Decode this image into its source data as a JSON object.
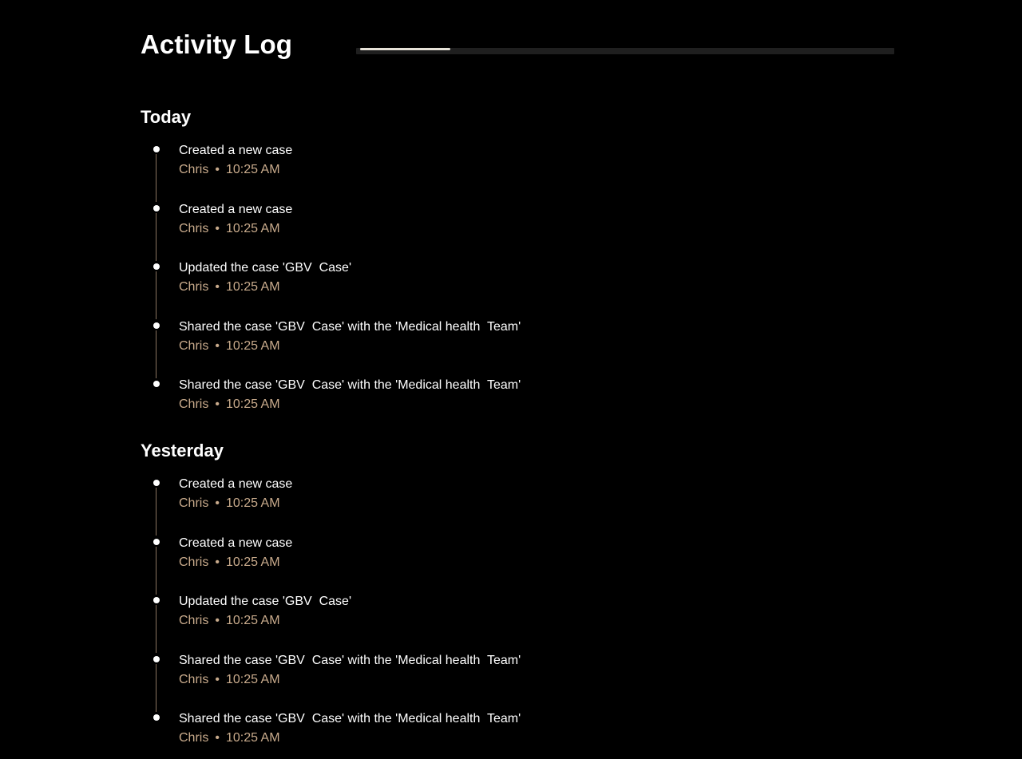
{
  "page": {
    "title": "Activity Log",
    "progress": 0.17
  },
  "sections": [
    {
      "heading": "Today",
      "items": [
        {
          "title": "Created a new case",
          "user": "Chris",
          "separator": "•",
          "time": "10:25 AM"
        },
        {
          "title": "Created a new case",
          "user": "Chris",
          "separator": "•",
          "time": "10:25 AM"
        },
        {
          "title": "Updated the case 'GBV  Case'",
          "user": "Chris",
          "separator": "•",
          "time": "10:25 AM"
        },
        {
          "title": "Shared the case 'GBV  Case' with the 'Medical health  Team'",
          "user": "Chris",
          "separator": "•",
          "time": "10:25 AM"
        },
        {
          "title": "Shared the case 'GBV  Case' with the 'Medical health  Team'",
          "user": "Chris",
          "separator": "•",
          "time": "10:25 AM"
        }
      ]
    },
    {
      "heading": "Yesterday",
      "items": [
        {
          "title": "Created a new case",
          "user": "Chris",
          "separator": "•",
          "time": "10:25 AM"
        },
        {
          "title": "Created a new case",
          "user": "Chris",
          "separator": "•",
          "time": "10:25 AM"
        },
        {
          "title": "Updated the case 'GBV  Case'",
          "user": "Chris",
          "separator": "•",
          "time": "10:25 AM"
        },
        {
          "title": "Shared the case 'GBV  Case' with the 'Medical health  Team'",
          "user": "Chris",
          "separator": "•",
          "time": "10:25 AM"
        },
        {
          "title": "Shared the case 'GBV  Case' with the 'Medical health  Team'",
          "user": "Chris",
          "separator": "•",
          "time": "10:25 AM"
        }
      ]
    }
  ],
  "colors": {
    "background": "#000000",
    "text": "#ffffff",
    "meta": "#c9ab8c",
    "timeline_line": "#8a7460",
    "progress_fill": "#e6e2d8",
    "progress_track": "#1f1f1f"
  }
}
